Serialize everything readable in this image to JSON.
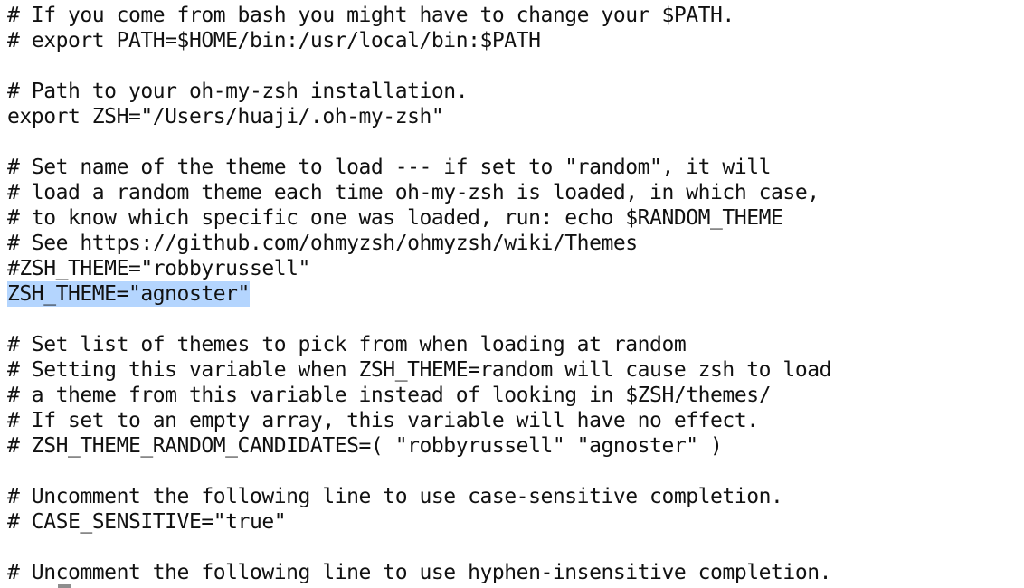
{
  "editor": {
    "lines": [
      "# If you come from bash you might have to change your $PATH.",
      "# export PATH=$HOME/bin:/usr/local/bin:$PATH",
      "",
      "# Path to your oh-my-zsh installation.",
      "export ZSH=\"/Users/huaji/.oh-my-zsh\"",
      "",
      "# Set name of the theme to load --- if set to \"random\", it will",
      "# load a random theme each time oh-my-zsh is loaded, in which case,",
      "# to know which specific one was loaded, run: echo $RANDOM_THEME",
      "# See https://github.com/ohmyzsh/ohmyzsh/wiki/Themes",
      "#ZSH_THEME=\"robbyrussell\"",
      "ZSH_THEME=\"agnoster\"",
      "",
      "# Set list of themes to pick from when loading at random",
      "# Setting this variable when ZSH_THEME=random will cause zsh to load",
      "# a theme from this variable instead of looking in $ZSH/themes/",
      "# If set to an empty array, this variable will have no effect.",
      "# ZSH_THEME_RANDOM_CANDIDATES=( \"robbyrussell\" \"agnoster\" )",
      "",
      "# Uncomment the following line to use case-sensitive completion.",
      "# CASE_SENSITIVE=\"true\"",
      "",
      "# Uncomment the following line to use hyphen-insensitive completion."
    ],
    "selected_line_index": 11,
    "selection_color": "#b4d5fe",
    "text_color": "#111111",
    "background_color": "#ffffff",
    "cursor_color": "#8e8e8e"
  }
}
